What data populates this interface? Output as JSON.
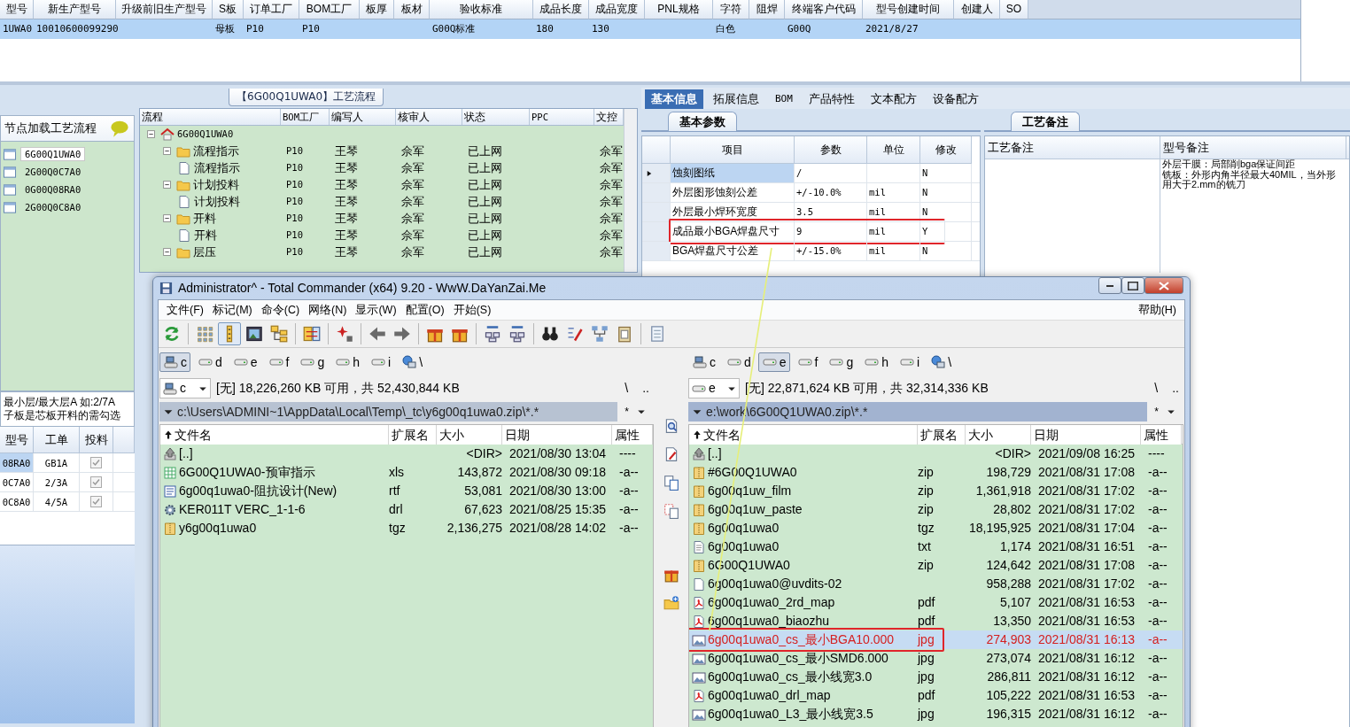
{
  "main_grid": {
    "columns": [
      "型号",
      "新生产型号",
      "升级前旧生产型号",
      "S板",
      "订单工厂",
      "BOM工厂",
      "板厚",
      "板材",
      "验收标准",
      "成品长度",
      "成品宽度",
      "PNL规格",
      "字符",
      "阻焊",
      "终端客户代码",
      "型号创建时间",
      "创建人",
      "SO"
    ],
    "rows": [
      {
        "selected": true,
        "cells": [
          "1UWA0",
          "10010600099290",
          null,
          "母板",
          "P10",
          "P10",
          null,
          null,
          "G00Q标准",
          "180",
          "130",
          null,
          "白色",
          null,
          "G00Q",
          "2021/8/27",
          null,
          null
        ]
      }
    ]
  },
  "node_panel": {
    "title": "节点加载工艺流程",
    "nodes": [
      {
        "label": "6G00Q1UWA0",
        "selected": true
      },
      {
        "label": "2G00Q0C7A0",
        "selected": false
      },
      {
        "label": "0G00Q08RA0",
        "selected": false
      },
      {
        "label": "2G00Q0C8A0",
        "selected": false
      }
    ]
  },
  "hint_lines": [
    "最小层/最大层A 如:2/7A",
    "子板是芯板开料的需勾选"
  ],
  "sub_table": {
    "columns": [
      "型号",
      "工单",
      "投料"
    ],
    "rows": [
      {
        "cells": [
          "08RA0",
          "GB1A"
        ],
        "selected": true,
        "checked": true
      },
      {
        "cells": [
          "0C7A0",
          "2/3A"
        ],
        "selected": false,
        "checked": true
      },
      {
        "cells": [
          "0C8A0",
          "4/5A"
        ],
        "selected": false,
        "checked": true
      }
    ]
  },
  "process_panel": {
    "title": "【6G00Q1UWA0】工艺流程",
    "columns": [
      "流程",
      "BOM工厂",
      "编写人",
      "核审人",
      "状态",
      "PPC",
      "文控"
    ],
    "tree": {
      "label": "6G00Q1UWA0",
      "kind": "root",
      "expanded": true,
      "children": [
        {
          "label": "流程指示",
          "kind": "folder",
          "expanded": true,
          "cells": [
            "P10",
            "王琴",
            "佘军",
            "已上网",
            null,
            "佘军"
          ],
          "children": [
            {
              "label": "流程指示",
              "kind": "page",
              "cells": [
                "P10",
                "王琴",
                "佘军",
                "已上网",
                null,
                "佘军"
              ]
            }
          ]
        },
        {
          "label": "计划投料",
          "kind": "folder",
          "expanded": true,
          "cells": [
            "P10",
            "王琴",
            "佘军",
            "已上网",
            null,
            "佘军"
          ],
          "children": [
            {
              "label": "计划投料",
              "kind": "page",
              "cells": [
                "P10",
                "王琴",
                "佘军",
                "已上网",
                null,
                "佘军"
              ]
            }
          ]
        },
        {
          "label": "开料",
          "kind": "folder",
          "expanded": true,
          "cells": [
            "P10",
            "王琴",
            "佘军",
            "已上网",
            null,
            "佘军"
          ],
          "children": [
            {
              "label": "开料",
              "kind": "page",
              "cells": [
                "P10",
                "王琴",
                "佘军",
                "已上网",
                null,
                "佘军"
              ]
            }
          ]
        },
        {
          "label": "层压",
          "kind": "folder",
          "expanded": true,
          "cells": [
            "P10",
            "王琴",
            "佘军",
            "已上网",
            null,
            "佘军"
          ]
        }
      ]
    }
  },
  "info_tabs": [
    {
      "label": "基本信息",
      "selected": true
    },
    {
      "label": "拓展信息",
      "selected": false
    },
    {
      "label": "BOM",
      "selected": false
    },
    {
      "label": "产品特性",
      "selected": false
    },
    {
      "label": "文本配方",
      "selected": false
    },
    {
      "label": "设备配方",
      "selected": false
    }
  ],
  "param_panel": {
    "title": "基本参数",
    "columns": [
      "项目",
      "参数",
      "单位",
      "修改"
    ],
    "rows": [
      {
        "cells": [
          "蚀刻图纸",
          "/",
          null,
          "N"
        ],
        "current": true,
        "selected": true,
        "boxed": false
      },
      {
        "cells": [
          "外层图形蚀刻公差",
          "+/-10.0%",
          "mil",
          "N"
        ],
        "current": false,
        "selected": false,
        "boxed": false
      },
      {
        "cells": [
          "外层最小焊环宽度",
          "3.5",
          "mil",
          "N"
        ],
        "current": false,
        "selected": false,
        "boxed": false
      },
      {
        "cells": [
          "成品最小BGA焊盘尺寸",
          "9",
          "mil",
          "Y"
        ],
        "current": false,
        "selected": false,
        "boxed": true
      },
      {
        "cells": [
          "BGA焊盘尺寸公差",
          "+/-15.0%",
          "mil",
          "N"
        ],
        "current": false,
        "selected": false,
        "boxed": false
      }
    ]
  },
  "note_panel": {
    "title": "工艺备注",
    "columns": [
      "工艺备注",
      "型号备注"
    ],
    "note_lines": [
      "外层干膜：局部削bga保证间距",
      "铣板：外形内角半径最大40MIL，当外形",
      "用大于2.mm的铣刀"
    ]
  },
  "tc_window": {
    "title": "Administrator^ - Total Commander (x64) 9.20 - WwW.DaYanZai.Me",
    "menu": [
      "文件(F)",
      "标记(M)",
      "命令(C)",
      "网络(N)",
      "显示(W)",
      "配置(O)",
      "开始(S)"
    ],
    "help_menu": "帮助(H)",
    "toolbar": [
      [
        {
          "selected": false
        }
      ],
      [
        {
          "selected": false
        },
        {
          "selected": true
        },
        {
          "selected": false
        },
        {
          "selected": false
        }
      ],
      [
        {
          "selected": false
        }
      ],
      [
        {
          "selected": false
        }
      ],
      [
        {
          "selected": false
        },
        {
          "selected": false
        }
      ],
      [
        {
          "selected": false
        },
        {
          "selected": false
        }
      ],
      [
        {
          "selected": false
        },
        {
          "selected": false
        }
      ],
      [
        {
          "selected": false
        },
        {
          "selected": false
        },
        {
          "selected": false
        },
        {
          "selected": false
        }
      ],
      [
        {
          "selected": false
        }
      ]
    ],
    "panes": [
      {
        "active": false,
        "drives": [
          {
            "label": "c",
            "kind": "system",
            "selected": true
          },
          {
            "label": "d",
            "kind": "drive",
            "selected": false
          },
          {
            "label": "e",
            "kind": "drive",
            "selected": false
          },
          {
            "label": "f",
            "kind": "drive",
            "selected": false
          },
          {
            "label": "g",
            "kind": "drive",
            "selected": false
          },
          {
            "label": "h",
            "kind": "drive",
            "selected": false
          },
          {
            "label": "i",
            "kind": "drive",
            "selected": false
          },
          {
            "label": "\\",
            "kind": "network",
            "selected": false
          }
        ],
        "drive": "c",
        "free_info": "[无] 18,226,260 KB 可用，共 52,430,844 KB",
        "root_button": "\\",
        "parent_button": "..",
        "path": "c:\\Users\\ADMINI~1\\AppData\\Local\\Temp\\_tc\\y6g00q1uwa0.zip\\*.*",
        "filter": "*",
        "columns": [
          {
            "label": "文件名",
            "sorted": true
          },
          {
            "label": "扩展名",
            "sorted": false
          },
          {
            "label": "大小",
            "sorted": false
          },
          {
            "label": "日期",
            "sorted": false
          },
          {
            "label": "属性",
            "sorted": false
          }
        ],
        "files": [
          {
            "name": "[..]",
            "size": "<DIR>",
            "date": "2021/08/30 13:04",
            "attr": "----",
            "kind": "up",
            "selected": false,
            "boxed": false
          },
          {
            "name": "6G00Q1UWA0-预审指示",
            "ext": "xls",
            "size": "143,872",
            "date": "2021/08/30 09:18",
            "attr": "-a--",
            "kind": "spreadsheet",
            "selected": false,
            "boxed": false
          },
          {
            "name": "6g00q1uwa0-阻抗设计(New)",
            "ext": "rtf",
            "size": "53,081",
            "date": "2021/08/30 13:00",
            "attr": "-a--",
            "kind": "document",
            "selected": false,
            "boxed": false
          },
          {
            "name": "KER011T VERC_1-1-6",
            "ext": "drl",
            "size": "67,623",
            "date": "2021/08/25 15:35",
            "attr": "-a--",
            "kind": "gear",
            "selected": false,
            "boxed": false
          },
          {
            "name": "y6g00q1uwa0",
            "ext": "tgz",
            "size": "2,136,275",
            "date": "2021/08/28 14:02",
            "attr": "-a--",
            "kind": "archive",
            "selected": false,
            "boxed": false
          }
        ]
      },
      {
        "active": true,
        "drives": [
          {
            "label": "c",
            "kind": "system",
            "selected": false
          },
          {
            "label": "d",
            "kind": "drive",
            "selected": false
          },
          {
            "label": "e",
            "kind": "drive",
            "selected": true
          },
          {
            "label": "f",
            "kind": "drive",
            "selected": false
          },
          {
            "label": "g",
            "kind": "drive",
            "selected": false
          },
          {
            "label": "h",
            "kind": "drive",
            "selected": false
          },
          {
            "label": "i",
            "kind": "drive",
            "selected": false
          },
          {
            "label": "\\",
            "kind": "network",
            "selected": false
          }
        ],
        "drive": "e",
        "free_info": "[无] 22,871,624 KB 可用，共 32,314,336 KB",
        "root_button": "\\",
        "parent_button": "..",
        "path": "e:\\work\\6G00Q1UWA0.zip\\*.*",
        "filter": "*",
        "columns": [
          {
            "label": "文件名",
            "sorted": true
          },
          {
            "label": "扩展名",
            "sorted": false
          },
          {
            "label": "大小",
            "sorted": false
          },
          {
            "label": "日期",
            "sorted": false
          },
          {
            "label": "属性",
            "sorted": false
          }
        ],
        "files": [
          {
            "name": "[..]",
            "size": "<DIR>",
            "date": "2021/09/08 16:25",
            "attr": "----",
            "kind": "up",
            "selected": false,
            "boxed": false
          },
          {
            "name": "#6G00Q1UWA0",
            "ext": "zip",
            "size": "198,729",
            "date": "2021/08/31 17:08",
            "attr": "-a--",
            "kind": "archive",
            "selected": false,
            "boxed": false
          },
          {
            "name": "6g00q1uw_film",
            "ext": "zip",
            "size": "1,361,918",
            "date": "2021/08/31 17:02",
            "attr": "-a--",
            "kind": "archive",
            "selected": false,
            "boxed": false
          },
          {
            "name": "6g00q1uw_paste",
            "ext": "zip",
            "size": "28,802",
            "date": "2021/08/31 17:02",
            "attr": "-a--",
            "kind": "archive",
            "selected": false,
            "boxed": false
          },
          {
            "name": "6g00q1uwa0",
            "ext": "tgz",
            "size": "18,195,925",
            "date": "2021/08/31 17:04",
            "attr": "-a--",
            "kind": "archive",
            "selected": false,
            "boxed": false
          },
          {
            "name": "6g00q1uwa0",
            "ext": "txt",
            "size": "1,174",
            "date": "2021/08/31 16:51",
            "attr": "-a--",
            "kind": "text",
            "selected": false,
            "boxed": false
          },
          {
            "name": "6G00Q1UWA0",
            "ext": "zip",
            "size": "124,642",
            "date": "2021/08/31 17:08",
            "attr": "-a--",
            "kind": "archive",
            "selected": false,
            "boxed": false
          },
          {
            "name": "6g00q1uwa0@uvdits-02",
            "size": "958,288",
            "date": "2021/08/31 17:02",
            "attr": "-a--",
            "kind": "blank",
            "selected": false,
            "boxed": false
          },
          {
            "name": "6g00q1uwa0_2rd_map",
            "ext": "pdf",
            "size": "5,107",
            "date": "2021/08/31 16:53",
            "attr": "-a--",
            "kind": "pdf",
            "selected": false,
            "boxed": false
          },
          {
            "name": "6g00q1uwa0_biaozhu",
            "ext": "pdf",
            "size": "13,350",
            "date": "2021/08/31 16:53",
            "attr": "-a--",
            "kind": "pdf",
            "selected": false,
            "boxed": false
          },
          {
            "name": "6g00q1uwa0_cs_最小BGA10.000",
            "ext": "jpg",
            "size": "274,903",
            "date": "2021/08/31 16:13",
            "attr": "-a--",
            "kind": "image",
            "selected": true,
            "boxed": true
          },
          {
            "name": "6g00q1uwa0_cs_最小SMD6.000",
            "ext": "jpg",
            "size": "273,074",
            "date": "2021/08/31 16:12",
            "attr": "-a--",
            "kind": "image",
            "selected": false,
            "boxed": false
          },
          {
            "name": "6g00q1uwa0_cs_最小线宽3.0",
            "ext": "jpg",
            "size": "286,811",
            "date": "2021/08/31 16:12",
            "attr": "-a--",
            "kind": "image",
            "selected": false,
            "boxed": false
          },
          {
            "name": "6g00q1uwa0_drl_map",
            "ext": "pdf",
            "size": "105,222",
            "date": "2021/08/31 16:53",
            "attr": "-a--",
            "kind": "pdf",
            "selected": false,
            "boxed": false
          },
          {
            "name": "6g00q1uwa0_L3_最小线宽3.5",
            "ext": "jpg",
            "size": "196,315",
            "date": "2021/08/31 16:12",
            "attr": "-a--",
            "kind": "image",
            "selected": false,
            "boxed": false
          }
        ]
      }
    ]
  }
}
